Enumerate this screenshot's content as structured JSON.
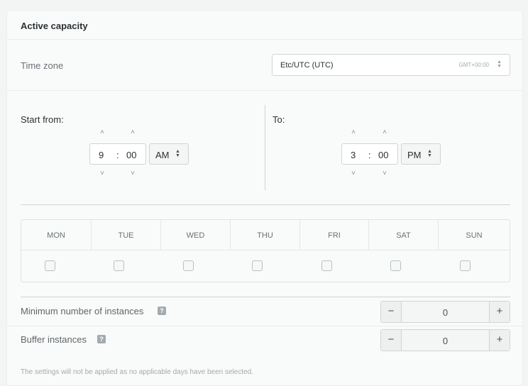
{
  "header": {
    "title": "Active capacity"
  },
  "timezone": {
    "label": "Time zone",
    "value": "Etc/UTC (UTC)",
    "offset": "GMT+00:00",
    "arrows": "▲\n▼"
  },
  "start": {
    "label": "Start from:",
    "hour": "9",
    "minute": "00",
    "separator": ":",
    "meridiem": "AM"
  },
  "end": {
    "label": "To:",
    "hour": "3",
    "minute": "00",
    "separator": ":",
    "meridiem": "PM"
  },
  "icons": {
    "up": "˄",
    "down": "˅",
    "updown": "▲\n▼"
  },
  "days": [
    {
      "name": "MON",
      "checked": false
    },
    {
      "name": "TUE",
      "checked": false
    },
    {
      "name": "WED",
      "checked": false
    },
    {
      "name": "THU",
      "checked": false
    },
    {
      "name": "FRI",
      "checked": false
    },
    {
      "name": "SAT",
      "checked": false
    },
    {
      "name": "SUN",
      "checked": false
    }
  ],
  "min_instances": {
    "label": "Minimum number of instances",
    "help": "?",
    "value": "0",
    "minus": "−",
    "plus": "+"
  },
  "buffer_instances": {
    "label": "Buffer instances",
    "help": "?",
    "value": "0",
    "minus": "−",
    "plus": "+"
  },
  "footnote": "The settings will not be applied as no applicable days have been selected."
}
